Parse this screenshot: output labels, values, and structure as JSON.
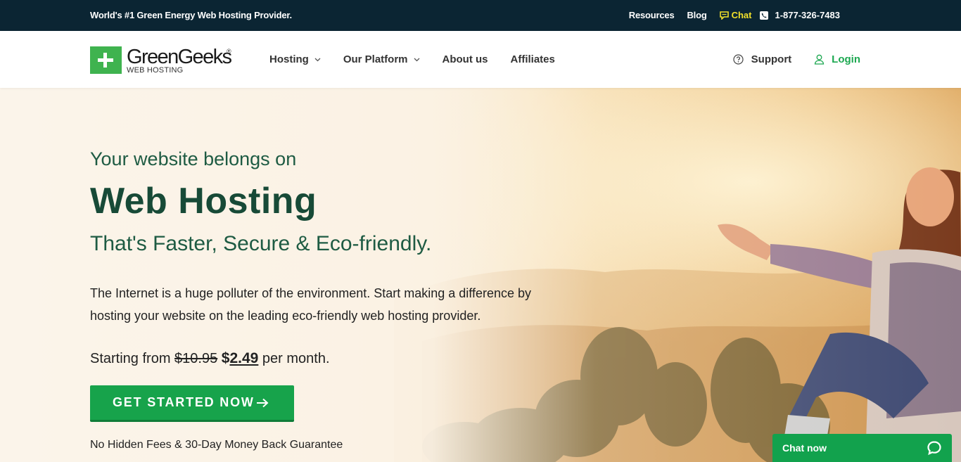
{
  "topbar": {
    "tagline": "World's #1 Green Energy Web Hosting Provider.",
    "links": [
      "Resources",
      "Blog"
    ],
    "chat_label": "Chat",
    "phone": "1-877-326-7483"
  },
  "logo": {
    "name": "GreenGeeks",
    "registered": "®",
    "subtitle": "WEB HOSTING"
  },
  "nav": {
    "items": [
      {
        "label": "Hosting",
        "dropdown": true
      },
      {
        "label": "Our Platform",
        "dropdown": true
      },
      {
        "label": "About us",
        "dropdown": false
      },
      {
        "label": "Affiliates",
        "dropdown": false
      }
    ],
    "support_label": "Support",
    "login_label": "Login"
  },
  "hero": {
    "pre_heading": "Your website belongs on",
    "headline": "Web Hosting",
    "subheading": "That's Faster, Secure & Eco-friendly.",
    "description": "The Internet is a huge polluter of the environment. Start making a difference by hosting your website on the leading eco-friendly web hosting provider.",
    "price_prefix": "Starting from ",
    "price_old": "$10.95",
    "price_currency": "$",
    "price_new": "2.49",
    "price_suffix": " per month.",
    "cta_label": "GET STARTED NOW",
    "guarantee": "No Hidden Fees & 30-Day Money Back Guarantee"
  },
  "chat_widget": {
    "label": "Chat now"
  },
  "colors": {
    "topbar_bg": "#0b2533",
    "brand_green": "#17a34b",
    "heading_green": "#174a37",
    "chat_yellow": "#f1e02b"
  },
  "icons": [
    "chat-bubble-icon",
    "phone-icon",
    "chevron-down-icon",
    "help-circle-icon",
    "user-icon",
    "arrow-right-icon",
    "chat-widget-icon"
  ]
}
